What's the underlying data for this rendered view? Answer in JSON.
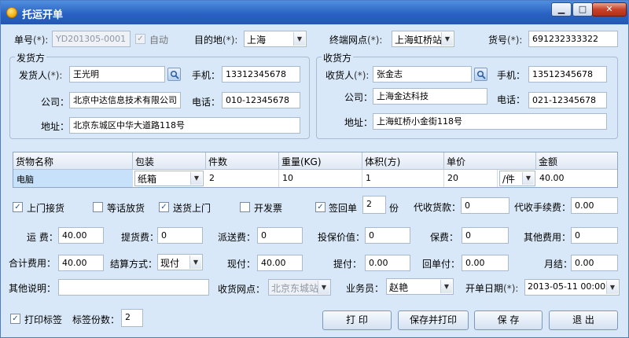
{
  "window": {
    "title": "托运开单",
    "min": "▁",
    "max": "□",
    "close": "✕"
  },
  "row1": {
    "order_no_label": "单号",
    "order_no_req": "(*):",
    "order_no_value": "YD201305-0001",
    "auto_label": "自动",
    "auto_checked": true,
    "dest_label": "目的地",
    "dest_req": "(*):",
    "dest_value": "上海",
    "terminal_label": "终端网点",
    "terminal_req": "(*):",
    "terminal_value": "上海虹桥站",
    "goods_no_label": "货号",
    "goods_no_req": "(*):",
    "goods_no_value": "691232333322"
  },
  "sender": {
    "group_title": "发货方",
    "name_label": "发货人",
    "name_req": "(*):",
    "name_value": "王光明",
    "mobile_label": "手机：",
    "mobile_value": "13312345678",
    "company_label": "公司：",
    "company_value": "北京中达信息技术有限公司",
    "phone_label": "电话：",
    "phone_value": "010-12345678",
    "address_label": "地址：",
    "address_value": "北京东城区中华大道路118号"
  },
  "receiver": {
    "group_title": "收货方",
    "name_label": "收货人",
    "name_req": "(*):",
    "name_value": "张金志",
    "mobile_label": "手机：",
    "mobile_value": "13512345678",
    "company_label": "公司：",
    "company_value": "上海金达科技",
    "phone_label": "电话：",
    "phone_value": "021-12345678",
    "address_label": "地址：",
    "address_value": "上海虹桥小金街118号"
  },
  "goods_table": {
    "headers": [
      "货物名称",
      "包装",
      "件数",
      "重量(KG)",
      "体积(方)",
      "单价",
      "金额"
    ],
    "row": {
      "name": "电脑",
      "package": "纸箱",
      "count": "2",
      "weight": "10",
      "volume": "1",
      "price": "20",
      "unit": "/件",
      "amount": "40.00"
    }
  },
  "options": {
    "pickup": {
      "label": "上门接货",
      "checked": true
    },
    "wait_notice": {
      "label": "等话放货",
      "checked": false
    },
    "deliver": {
      "label": "送货上门",
      "checked": true
    },
    "invoice": {
      "label": "开发票",
      "checked": false
    },
    "receipt": {
      "label": "签回单",
      "checked": true,
      "count": "2",
      "unit": "份"
    },
    "cod_label": "代收货款：",
    "cod_value": "0",
    "cod_fee_label": "代收手续费：",
    "cod_fee_value": "0.00"
  },
  "fees": {
    "freight_label": "运 费：",
    "freight_value": "40.00",
    "pickup_fee_label": "提货费：",
    "pickup_fee_value": "0",
    "delivery_fee_label": "派送费：",
    "delivery_fee_value": "0",
    "insured_label": "投保价值：",
    "insured_value": "0",
    "premium_label": "保费：",
    "premium_value": "0",
    "other_fee_label": "其他费用：",
    "other_fee_value": "0"
  },
  "totals": {
    "total_label": "合计费用：",
    "total_value": "40.00",
    "settle_label": "结算方式：",
    "settle_value": "现付",
    "cash_label": "现付：",
    "cash_value": "40.00",
    "collect_label": "提付：",
    "collect_value": "0.00",
    "return_label": "回单付：",
    "return_value": "0.00",
    "monthly_label": "月结：",
    "monthly_value": "0.00"
  },
  "misc": {
    "remark_label": "其他说明：",
    "remark_value": "",
    "recv_point_label": "收货网点：",
    "recv_point_value": "北京东城站",
    "salesman_label": "业务员：",
    "salesman_value": "赵艳",
    "date_label": "开单日期",
    "date_req": "(*):",
    "date_value": "2013-05-11 00:00"
  },
  "footer": {
    "print_label_text": "打印标签",
    "print_label_checked": true,
    "label_copies_label": "标签份数：",
    "label_copies_value": "2",
    "print_btn": "打 印",
    "save_print_btn": "保存并打印",
    "save_btn": "保 存",
    "exit_btn": "退 出"
  }
}
